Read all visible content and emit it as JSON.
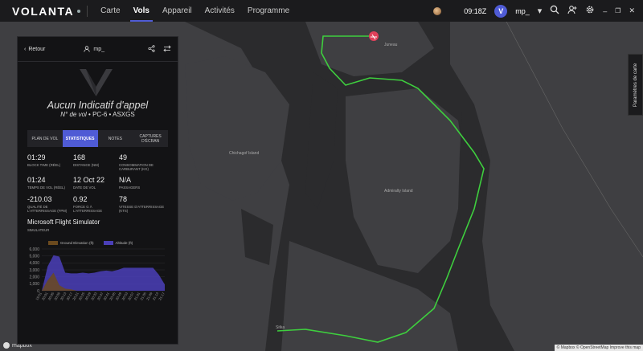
{
  "app": {
    "name": "VOLANTA"
  },
  "nav": [
    "Carte",
    "Vols",
    "Appareil",
    "Activités",
    "Programme"
  ],
  "topbar": {
    "time": "09:18Z",
    "user": "mp_",
    "badge": "V"
  },
  "panel": {
    "back": "Retour",
    "user": "mp_",
    "callsign": "Aucun Indicatif d'appel",
    "flight_no": "N° de vol",
    "aircraft": "PC-6",
    "registration": "ASXGS",
    "tabs": [
      {
        "label": "PLAN DE VOL",
        "active": false
      },
      {
        "label": "STATISTIQUES",
        "active": true
      },
      {
        "label": "NOTES",
        "active": false
      },
      {
        "label": "CAPTURES D'ÉCRAN",
        "active": false
      }
    ],
    "stats": [
      {
        "value": "01:29",
        "label": "BLOCK TIME (RÉEL)"
      },
      {
        "value": "168",
        "label": "DISTANCE (NM)"
      },
      {
        "value": "49",
        "label": "CONSOMMATION DE CARBURANT (KG)"
      },
      {
        "value": "01:24",
        "label": "TEMPS DE VOL (RÉEL)"
      },
      {
        "value": "12 Oct 22",
        "label": "DATE DE VOL"
      },
      {
        "value": "N/A",
        "label": "PASSAGERS"
      },
      {
        "value": "-210.03",
        "label": "QUALITÉ DE L'ATTERRISSAGE (FPM)"
      },
      {
        "value": "0.92",
        "label": "FORCE G À L'ATTERRISSAGE"
      },
      {
        "value": "78",
        "label": "VITESSE D'ATTERRISSAGE (KTS)"
      }
    ],
    "simulator": "Microsoft Flight Simulator",
    "simulator_label": "SIMULATEUR"
  },
  "chart_data": {
    "type": "area",
    "series": [
      {
        "name": "Ground Elevation (ft)",
        "color": "#6b4a1e"
      },
      {
        "name": "Altitude (ft)",
        "color": "#4b3fb8"
      }
    ],
    "yticks": [
      0,
      1000,
      2000,
      3000,
      4000,
      5000,
      6000
    ],
    "ylim": [
      0,
      6000
    ],
    "xticks": [
      "19:51",
      "20:01",
      "20:05",
      "20:09",
      "20:13",
      "20:17",
      "20:21",
      "20:25",
      "20:29",
      "20:33",
      "20:37",
      "20:41",
      "20:45",
      "20:49",
      "20:53",
      "20:57",
      "21:01",
      "21:05",
      "21:09",
      "21:13",
      "21:17"
    ],
    "altitude": [
      0,
      3500,
      5100,
      4900,
      2600,
      2500,
      2500,
      2600,
      2500,
      2600,
      2800,
      2900,
      2800,
      3000,
      3300,
      3300,
      3300,
      3300,
      3300,
      3300,
      2300,
      900
    ],
    "ground": [
      0,
      1500,
      2600,
      800,
      300,
      200,
      0,
      0,
      0,
      0,
      0,
      0,
      0,
      0,
      0,
      0,
      0,
      0,
      0,
      0,
      0,
      0
    ]
  },
  "map": {
    "labels": [
      "Juneau",
      "Chichagof Island",
      "Admiralty Island",
      "Sitka"
    ],
    "settings_button": "Paramètres de carte",
    "attribution": "© Mapbox © OpenStreetMap Improve this map",
    "brand": "mapbox"
  }
}
